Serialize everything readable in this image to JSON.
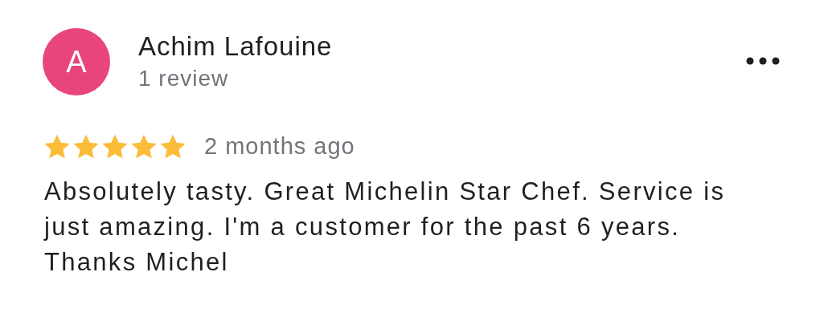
{
  "reviewer": {
    "initial": "A",
    "name": "Achim Lafouine",
    "review_count": "1 review"
  },
  "review": {
    "stars": 5,
    "time": "2 months ago",
    "text": "Absolutely tasty. Great Michelin Star Chef. Service is just amazing. I'm a customer for the past 6 years. Thanks Michel"
  }
}
